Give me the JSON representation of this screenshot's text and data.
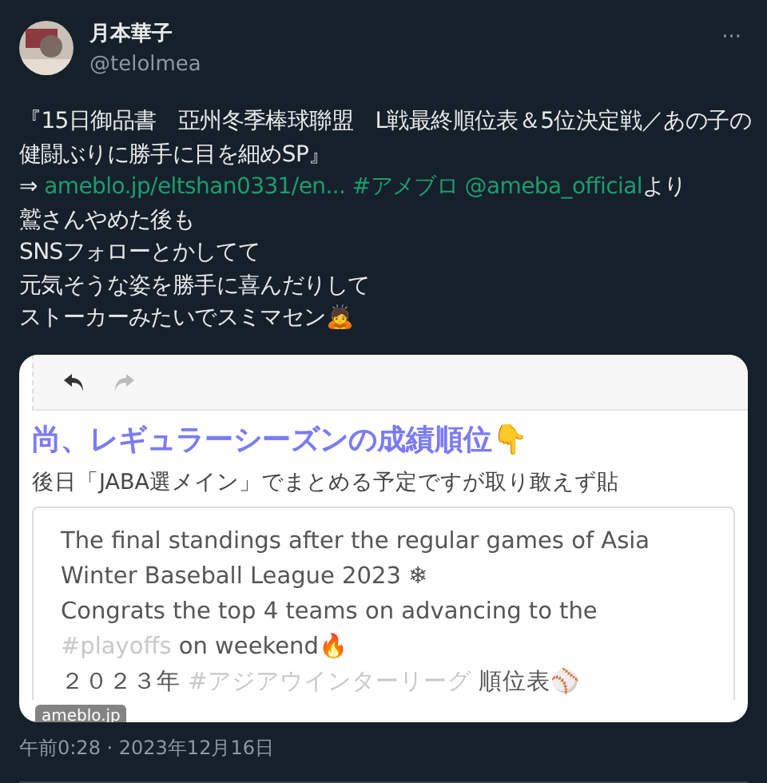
{
  "author": {
    "name": "月本華子",
    "handle": "@telolmea"
  },
  "more_menu": "···",
  "body_lines": [
    [
      {
        "kind": "text",
        "text": "『15日御品書　亞州冬季棒球聯盟　L戦最終順位表＆5位決定戦／あの子の"
      }
    ],
    [
      {
        "kind": "text",
        "text": "健闘ぶりに勝手に目を細めSP』"
      }
    ],
    [
      {
        "kind": "text",
        "text": "⇒ "
      },
      {
        "kind": "link",
        "text": "ameblo.jp/eltshan0331/en..."
      },
      {
        "kind": "link",
        "text": "#アメブロ"
      },
      {
        "kind": "link",
        "text": "@ameba_official"
      },
      {
        "kind": "text",
        "text": "より"
      }
    ],
    [
      {
        "kind": "text",
        "text": "鷲さんやめた後も"
      }
    ],
    [
      {
        "kind": "text",
        "text": "SNSフォローとかしてて"
      }
    ],
    [
      {
        "kind": "text",
        "text": "元気そうな姿を勝手に喜んだりして"
      }
    ],
    [
      {
        "kind": "text",
        "text": "ストーカーみたいでスミマセン🙇"
      }
    ]
  ],
  "card": {
    "title": "尚、レギュラーシーズンの成績順位👇",
    "subtitle": "後日「JABA選メイン」でまとめる予定ですが取り敢えず貼",
    "embed_lines": [
      [
        {
          "kind": "text",
          "text": "The final standings after the regular games of Asia"
        }
      ],
      [
        {
          "kind": "text",
          "text": "Winter Baseball League 2023 ❄"
        }
      ],
      [
        {
          "kind": "text",
          "text": "Congrats the top 4 teams on advancing to the"
        }
      ],
      [
        {
          "kind": "link",
          "text": "#playoffs"
        },
        {
          "kind": "text",
          "text": " on weekend🔥"
        }
      ],
      [
        {
          "kind": "text",
          "text": "２０２３年 "
        },
        {
          "kind": "link",
          "text": "#アジアウインターリーグ"
        },
        {
          "kind": "text",
          "text": " 順位表⚾"
        }
      ]
    ],
    "domain": "ameblo.jp"
  },
  "timestamp": "午前0:28 · 2023年12月16日"
}
